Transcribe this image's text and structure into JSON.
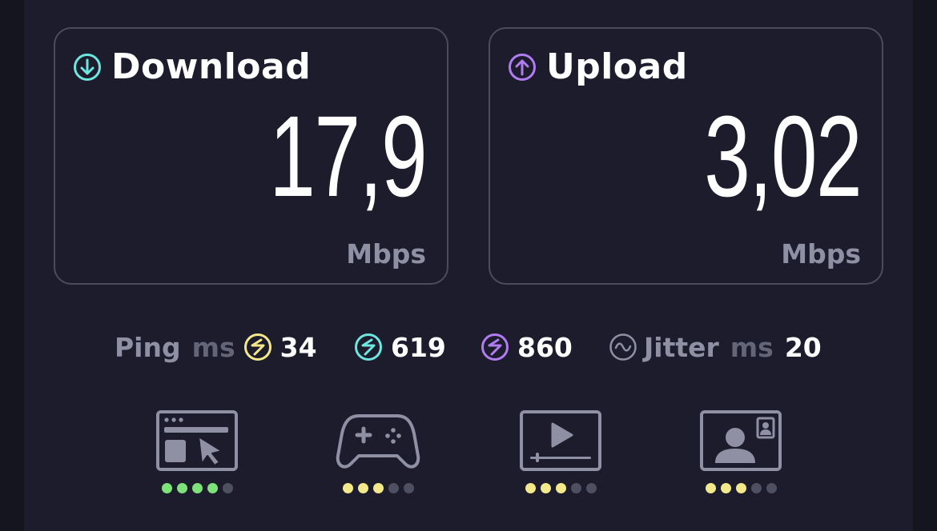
{
  "download": {
    "title": "Download",
    "value": "17,9",
    "unit": "Mbps",
    "icon": "arrow-down-circle-icon",
    "color": "#6ee6e0"
  },
  "upload": {
    "title": "Upload",
    "value": "3,02",
    "unit": "Mbps",
    "icon": "arrow-up-circle-icon",
    "color": "#b07cf0"
  },
  "ping": {
    "label": "Ping",
    "unit": "ms",
    "idle": {
      "value": "34",
      "color": "#f3e88a"
    },
    "download": {
      "value": "619",
      "color": "#6ee6e0"
    },
    "upload": {
      "value": "860",
      "color": "#b07cf0"
    }
  },
  "jitter": {
    "label": "Jitter",
    "unit": "ms",
    "value": "20"
  },
  "activities": [
    {
      "name": "web-browsing-icon",
      "rating": 4,
      "of": 5,
      "color": "#7ee27a"
    },
    {
      "name": "gaming-icon",
      "rating": 3,
      "of": 5,
      "color": "#f3e88a"
    },
    {
      "name": "video-streaming-icon",
      "rating": 3,
      "of": 5,
      "color": "#f3e88a"
    },
    {
      "name": "video-call-icon",
      "rating": 3,
      "of": 5,
      "color": "#f3e88a"
    }
  ]
}
